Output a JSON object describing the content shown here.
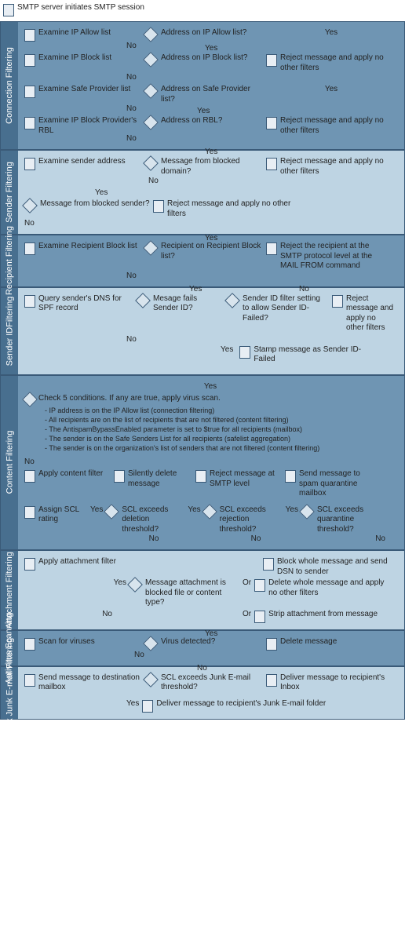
{
  "start": "SMTP server initiates SMTP session",
  "yes": "Yes",
  "no": "No",
  "or": "Or",
  "sections": {
    "connection": {
      "label": "Connection Filtering",
      "rows": [
        {
          "proc": "Examine IP Allow list",
          "dec": "Address on IP Allow list?"
        },
        {
          "proc": "Examine IP Block list",
          "dec": "Address on IP Block list?",
          "term": "Reject message and apply no other filters"
        },
        {
          "proc": "Examine Safe Provider list",
          "dec": "Address on Safe Provider list?"
        },
        {
          "proc": "Examine IP Block Provider's RBL",
          "dec": "Address on RBL?",
          "term": "Reject message and apply no other filters"
        }
      ]
    },
    "sender": {
      "label": "Sender Filtering",
      "row1": {
        "proc": "Examine sender address",
        "dec": "Message from blocked domain?",
        "term": "Reject message and apply no other filters"
      },
      "row2": {
        "dec": "Message from blocked sender?",
        "term": "Reject message and apply no other filters"
      }
    },
    "recipient": {
      "label": "Recipient Filtering",
      "proc": "Examine Recipient Block list",
      "dec": "Recipient on Recipient Block list?",
      "term": "Reject the recipient at the SMTP protocol level at the MAIL FROM command"
    },
    "senderid": {
      "label": "Sender IDFiltering",
      "proc": "Query sender's DNS for SPF record",
      "dec1": "Mesage fails Sender ID?",
      "dec2": "Sender ID filter setting to allow Sender ID-Failed?",
      "term_reject": "Reject message and apply no other filters",
      "term_stamp": "Stamp message as Sender ID-Failed"
    },
    "content": {
      "label": "Content Filtering",
      "cond_title": "Check 5 conditions. If any are true, apply virus scan.",
      "conds": [
        "IP address is on the IP Allow list (connection filtering)",
        "All recipients are on the list of recipients that are not filtered (content filtering)",
        "The AntispamBypassEnabled parameter is set to $true for all recipients (mailbox)",
        "The sender is on the Safe Senders List for all recipients (safelist aggregation)",
        "The sender is on the organization's list of senders that are not filtered (content filtering)"
      ],
      "apply": "Apply content filter",
      "assign": "Assign SCL rating",
      "silent": "Silently delete message",
      "dec_del": "SCL exceeds deletion threshold?",
      "rej_smtp": "Reject message at SMTP level",
      "dec_rej": "SCL exceeds rejection threshold?",
      "quar": "Send message to spam quarantine mailbox",
      "dec_quar": "SCL exceeds quarantine threshold?"
    },
    "attach": {
      "label": "Attachment Filtering",
      "proc": "Apply attachment filter",
      "dec": "Message attachment is blocked file or content  type?",
      "t1": "Block whole message and send DSN to sender",
      "t2": "Delete whole message and apply no other filters",
      "t3": "Strip attachment from message"
    },
    "antivirus": {
      "label": "Antivirus Scanning",
      "proc": "Scan for viruses",
      "dec": "Virus detected?",
      "term": "Delete message"
    },
    "outlook": {
      "label": "Outlook Junk E-mail Filtering",
      "proc": "Send message to destination mailbox",
      "dec": "SCL exceeds Junk E-mail threshold?",
      "term_inbox": "Deliver message to recipient's Inbox",
      "term_junk": "Deliver message to recipient's Junk E-mail folder"
    }
  }
}
